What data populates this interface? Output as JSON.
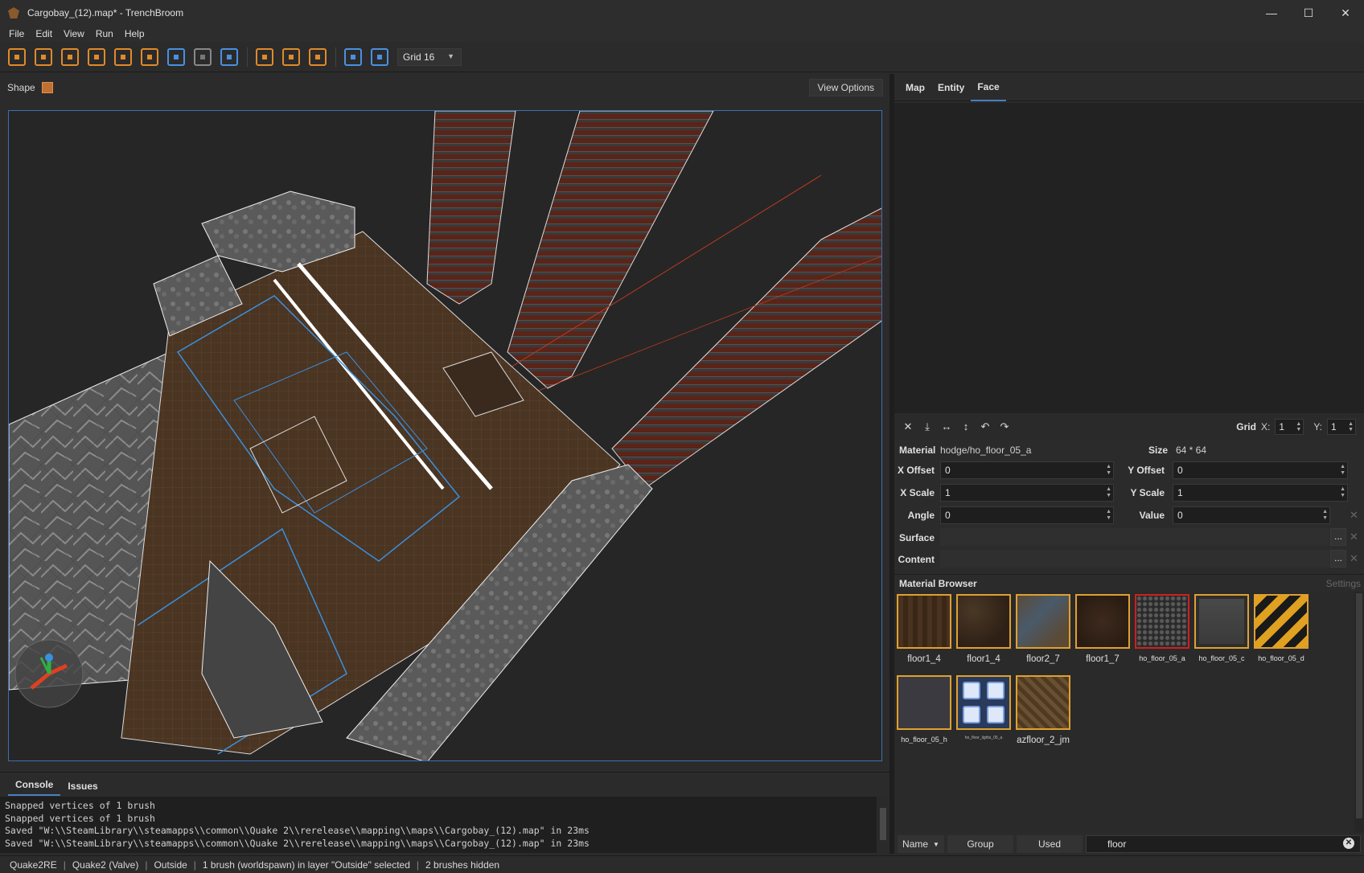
{
  "window": {
    "title": "Cargobay_(12).map* - TrenchBroom",
    "minimize": "—",
    "maximize": "☐",
    "close": "✕"
  },
  "menu": [
    "File",
    "Edit",
    "View",
    "Run",
    "Help"
  ],
  "toolbar": {
    "grid": "Grid 16"
  },
  "viewport": {
    "shape_label": "Shape",
    "view_options": "View Options"
  },
  "console": {
    "tabs": [
      "Console",
      "Issues"
    ],
    "lines": [
      "Snapped vertices of 1 brush",
      "Snapped vertices of 1 brush",
      "Saved \"W:\\\\SteamLibrary\\\\steamapps\\\\common\\\\Quake 2\\\\rerelease\\\\mapping\\\\maps\\\\Cargobay_(12).map\" in 23ms",
      "Saved \"W:\\\\SteamLibrary\\\\steamapps\\\\common\\\\Quake 2\\\\rerelease\\\\mapping\\\\maps\\\\Cargobay_(12).map\" in 23ms"
    ]
  },
  "inspector": {
    "tabs": [
      "Map",
      "Entity",
      "Face"
    ],
    "active_tab": "Face"
  },
  "face": {
    "grid_label": "Grid",
    "grid_x_label": "X:",
    "grid_x": "1",
    "grid_y_label": "Y:",
    "grid_y": "1",
    "material_label": "Material",
    "material": "hodge/ho_floor_05_a",
    "size_label": "Size",
    "size": "64 * 64",
    "x_offset_label": "X Offset",
    "x_offset": "0",
    "y_offset_label": "Y Offset",
    "y_offset": "0",
    "x_scale_label": "X Scale",
    "x_scale": "1",
    "y_scale_label": "Y Scale",
    "y_scale": "1",
    "angle_label": "Angle",
    "angle": "0",
    "value_label": "Value",
    "value": "0",
    "surface_label": "Surface",
    "content_label": "Content",
    "dots": "..."
  },
  "material_browser": {
    "title": "Material Browser",
    "settings": "Settings",
    "materials": [
      {
        "name": "floor1_4"
      },
      {
        "name": "floor1_4"
      },
      {
        "name": "floor2_7"
      },
      {
        "name": "floor1_7"
      },
      {
        "name": "ho_floor_05_a"
      },
      {
        "name": "ho_floor_05_c"
      },
      {
        "name": "ho_floor_05_d"
      },
      {
        "name": "ho_floor_05_h"
      },
      {
        "name": "ho_floor_lights_05_a"
      },
      {
        "name": "azfloor_2_jm"
      }
    ],
    "sort_button": "Name",
    "group_button": "Group",
    "used_button": "Used",
    "search_value": "floor"
  },
  "status": [
    "Quake2RE",
    "Quake2 (Valve)",
    "Outside",
    "1 brush (worldspawn) in layer \"Outside\" selected",
    "2 brushes hidden"
  ]
}
